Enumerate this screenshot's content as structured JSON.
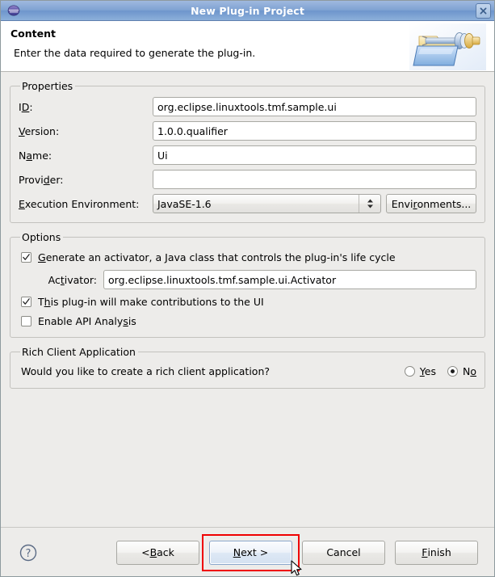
{
  "window": {
    "title": "New Plug-in Project",
    "app_icon": "eclipse-logo-icon",
    "close_icon": "close-icon"
  },
  "header": {
    "title": "Content",
    "description": "Enter the data required to generate the plug-in.",
    "icon": "plugin-folder-icon"
  },
  "properties": {
    "legend": "Properties",
    "fields": [
      {
        "label_pre": "I",
        "label_mn": "D",
        "label_post": ":",
        "value": "org.eclipse.linuxtools.tmf.sample.ui"
      },
      {
        "label_pre": "",
        "label_mn": "V",
        "label_post": "ersion:",
        "value": "1.0.0.qualifier"
      },
      {
        "label_pre": "N",
        "label_mn": "a",
        "label_post": "me:",
        "value": "Ui"
      },
      {
        "label_pre": "Provi",
        "label_mn": "d",
        "label_post": "er:",
        "value": ""
      }
    ],
    "execution_environment": {
      "label_pre": "",
      "label_mn": "E",
      "label_post": "xecution Environment:",
      "selected": "JavaSE-1.6",
      "options": [
        "JavaSE-1.6"
      ]
    },
    "environments_button": {
      "pre": "Envi",
      "mn": "r",
      "post": "onments..."
    }
  },
  "options": {
    "legend": "Options",
    "generate_activator": {
      "checked": true,
      "pre": "",
      "mn": "G",
      "post": "enerate an activator, a Java class that controls the plug-in's life cycle"
    },
    "activator": {
      "label_pre": "Ac",
      "label_mn": "t",
      "label_post": "ivator:",
      "value": "org.eclipse.linuxtools.tmf.sample.ui.Activator"
    },
    "ui_contributions": {
      "checked": true,
      "pre": "T",
      "mn": "h",
      "post": "is plug-in will make contributions to the UI"
    },
    "api_analysis": {
      "checked": false,
      "pre": "Enable API Analy",
      "mn": "s",
      "post": "is"
    }
  },
  "rich_client": {
    "legend": "Rich Client Application",
    "question": "Would you like to create a rich client application?",
    "yes": {
      "pre": "",
      "mn": "Y",
      "post": "es",
      "selected": false
    },
    "no": {
      "pre": "N",
      "mn": "o",
      "post": "",
      "selected": true
    }
  },
  "footer": {
    "help_icon": "help-question-icon",
    "back": {
      "pre": "< ",
      "mn": "B",
      "post": "ack"
    },
    "next": {
      "pre": "",
      "mn": "N",
      "post": "ext >"
    },
    "cancel": {
      "pre": "Cancel",
      "mn": "",
      "post": ""
    },
    "finish": {
      "pre": "",
      "mn": "F",
      "post": "inish"
    },
    "highlight_color": "#ef0000",
    "focused_button": "next"
  }
}
